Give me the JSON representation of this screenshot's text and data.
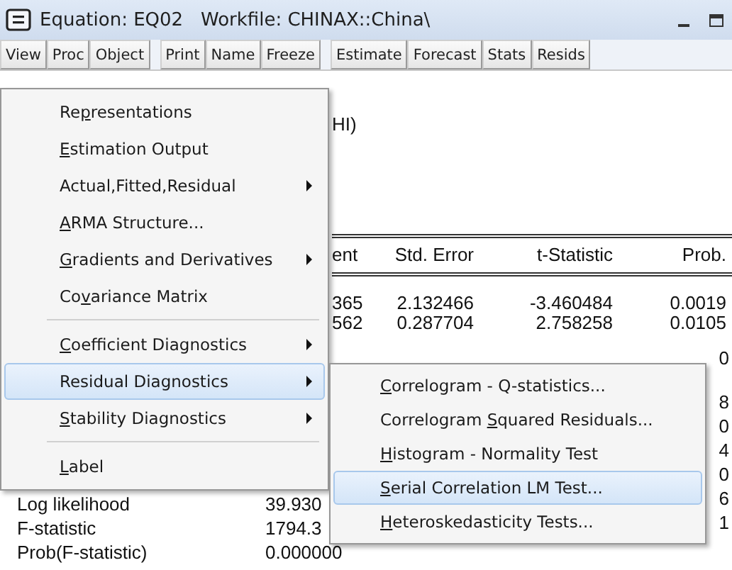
{
  "window": {
    "title": "Equation: EQ02   Workfile: CHINAX::China\\"
  },
  "toolbar": {
    "groups": [
      [
        {
          "label": "View"
        },
        {
          "label": "Proc"
        },
        {
          "label": "Object"
        }
      ],
      [
        {
          "label": "Print"
        },
        {
          "label": "Name"
        },
        {
          "label": "Freeze"
        }
      ],
      [
        {
          "label": "Estimate"
        },
        {
          "label": "Forecast"
        },
        {
          "label": "Stats"
        },
        {
          "label": "Resids"
        }
      ]
    ]
  },
  "output": {
    "header_note": "HI)",
    "table": {
      "columns": [
        "ent",
        "Std. Error",
        "t-Statistic",
        "Prob."
      ],
      "rows": [
        [
          "365",
          "2.132466",
          "-3.460484",
          "0.0019"
        ],
        [
          "562",
          "0.287704",
          "2.758258",
          "0.0105"
        ]
      ],
      "column_4_fragments": [
        "0",
        "8",
        "0",
        "4",
        "0",
        "6",
        "1"
      ]
    },
    "stats": [
      {
        "label": "Log likelihood",
        "value": "39.930"
      },
      {
        "label": "F-statistic",
        "value": "1794.3"
      },
      {
        "label": "Prob(F-statistic)",
        "value": "0.000000"
      }
    ]
  },
  "menu": {
    "items": [
      {
        "kind": "item",
        "pre": "Re",
        "key": "p",
        "post": "resentations",
        "submenu": false,
        "selected": false
      },
      {
        "kind": "item",
        "key": "E",
        "post": "stimation Output",
        "submenu": false,
        "selected": false
      },
      {
        "kind": "item",
        "pre": "Actual,Fitted,Residual",
        "submenu": true,
        "selected": false
      },
      {
        "kind": "item",
        "key": "A",
        "post": "RMA Structure...",
        "submenu": false,
        "selected": false
      },
      {
        "kind": "item",
        "key": "G",
        "post": "radients and Derivatives",
        "submenu": true,
        "selected": false
      },
      {
        "kind": "item",
        "pre": "Co",
        "key": "v",
        "post": "ariance Matrix",
        "submenu": false,
        "selected": false
      },
      {
        "kind": "separator"
      },
      {
        "kind": "item",
        "key": "C",
        "post": "oefficient Diagnostics",
        "submenu": true,
        "selected": false
      },
      {
        "kind": "item",
        "pre": "Residual Diagnostics",
        "submenu": true,
        "selected": true
      },
      {
        "kind": "item",
        "key": "S",
        "post": "tability Diagnostics",
        "submenu": true,
        "selected": false
      },
      {
        "kind": "separator"
      },
      {
        "kind": "item",
        "key": "L",
        "post": "abel",
        "submenu": false,
        "selected": false
      }
    ]
  },
  "submenu": {
    "items": [
      {
        "kind": "item",
        "key": "C",
        "post": "orrelogram - Q-statistics...",
        "submenu": false,
        "selected": false
      },
      {
        "kind": "item",
        "pre": "Correlogram ",
        "key": "S",
        "post": "quared Residuals...",
        "submenu": false,
        "selected": false
      },
      {
        "kind": "item",
        "key": "H",
        "post": "istogram - Normality Test",
        "submenu": false,
        "selected": false
      },
      {
        "kind": "item",
        "key": "S",
        "post": "erial Correlation LM Test...",
        "submenu": false,
        "selected": true
      },
      {
        "kind": "item",
        "key": "H",
        "post": "eteroskedasticity Tests...",
        "submenu": false,
        "selected": false
      }
    ]
  }
}
